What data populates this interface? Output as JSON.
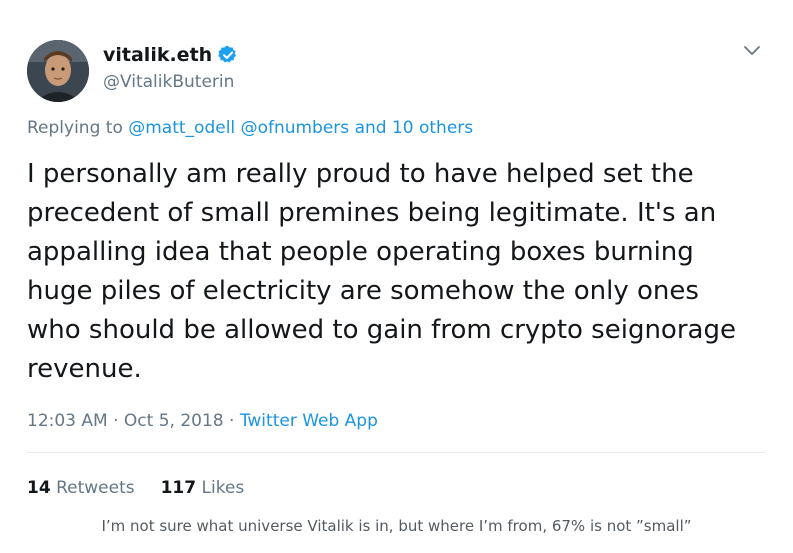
{
  "author": {
    "display_name": "vitalik.eth",
    "handle": "@VitalikButerin",
    "verified_icon": "verified-badge-icon",
    "badge_color": "#1da1f2"
  },
  "reply_context": {
    "prefix": "Replying to",
    "mention_1": "@matt_odell",
    "mention_2": "@ofnumbers",
    "others": "and 10 others"
  },
  "tweet": {
    "text": "I personally am really proud to have helped set the\nprecedent of small premines being legitimate. It's an\nappalling idea that people operating boxes burning\nhuge piles of electricity are somehow the only ones\nwho should be allowed to gain from crypto seignorage\nrevenue."
  },
  "meta": {
    "time": "12:03 AM",
    "sep1": " · ",
    "date": "Oct 5, 2018",
    "sep2": " · ",
    "source": "Twitter Web App"
  },
  "stats": {
    "retweets_count": "14",
    "retweets_label": " Retweets",
    "likes_count": "117",
    "likes_label": " Likes"
  },
  "caption": "I’m not sure what universe Vitalik is in, but where I’m from, 67% is not ”small”",
  "colors": {
    "link": "#1b95e0",
    "secondary_text": "#657786",
    "primary_text": "#14171a"
  }
}
